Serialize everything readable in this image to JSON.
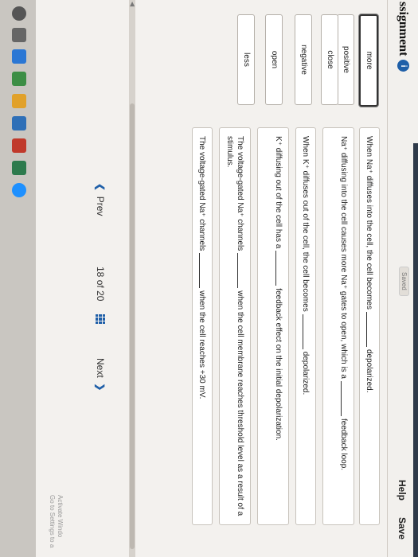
{
  "header": {
    "title": "ssignment",
    "info_glyph": "i",
    "saved": "Saved",
    "help": "Help",
    "save": "Save"
  },
  "word_bank": [
    "more",
    "positive",
    "close",
    "negative",
    "open",
    "less"
  ],
  "statements": [
    {
      "before": "When Na⁺ diffuses into the cell, the cell becomes",
      "after": "depolarized."
    },
    {
      "before": "Na⁺ diffusing into the cell causes more Na⁺ gates to open, which is a",
      "after": "feedback loop."
    },
    {
      "before": "When K⁺ diffuses out of the cell, the cell becomes",
      "after": "depolarized."
    },
    {
      "before": "K⁺ diffusing out of the cell has a",
      "after": "feedback effect on the initial depolarization."
    },
    {
      "before": "The voltage-gated Na⁺ channels",
      "after": "when the cell membrane reaches threshold level as a result of a stimulus."
    },
    {
      "before": "The voltage-gated Na⁺ channels",
      "after": "when the cell reaches +30 mV."
    }
  ],
  "nav": {
    "prev": "Prev",
    "current": "18",
    "of": "of",
    "total": "20",
    "next": "Next"
  },
  "watermark": {
    "line1": "Activate Windo",
    "line2": "Go to Settings to a"
  },
  "colors": {
    "accent": "#1f5fa8"
  }
}
